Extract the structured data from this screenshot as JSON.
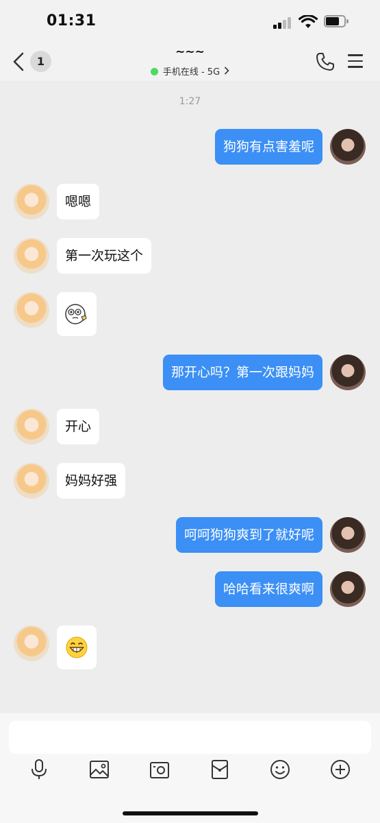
{
  "status_bar": {
    "time": "01:31"
  },
  "nav": {
    "unread_count": "1",
    "title": "~~~",
    "presence": "手机在线 - 5G"
  },
  "chat": {
    "timestamp": "1:27",
    "messages": [
      {
        "side": "out",
        "text": "狗狗有点害羞呢"
      },
      {
        "side": "in",
        "text": "嗯嗯"
      },
      {
        "side": "in",
        "text": "第一次玩这个"
      },
      {
        "side": "in",
        "type": "emoji",
        "emoji": "thinking-sticker"
      },
      {
        "side": "out",
        "text": "那开心吗？第一次跟妈妈"
      },
      {
        "side": "in",
        "text": "开心"
      },
      {
        "side": "in",
        "text": "妈妈好强"
      },
      {
        "side": "out",
        "text": "呵呵狗狗爽到了就好呢"
      },
      {
        "side": "out",
        "text": "哈哈看来很爽啊"
      },
      {
        "side": "in",
        "type": "emoji",
        "emoji": "grinning-face"
      }
    ]
  },
  "composer": {
    "input_value": "",
    "tools": [
      "microphone-icon",
      "image-icon",
      "camera-icon",
      "red-packet-icon",
      "emoji-icon",
      "plus-icon"
    ]
  },
  "colors": {
    "outgoing_bubble": "#3b8ff5",
    "incoming_bubble": "#ffffff",
    "online_dot": "#4cd964",
    "background": "#ededed"
  }
}
